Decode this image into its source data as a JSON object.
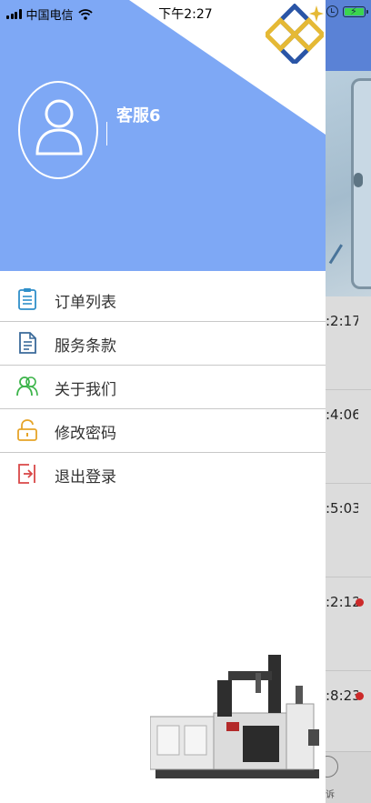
{
  "status_bar": {
    "carrier": "中国电信",
    "time": "下午2:27"
  },
  "drawer": {
    "username": "客服6",
    "menu": [
      {
        "label": "订单列表",
        "icon": "clipboard-icon",
        "color": "#2f8fc9"
      },
      {
        "label": "服务条款",
        "icon": "document-icon",
        "color": "#3a6a9a"
      },
      {
        "label": "关于我们",
        "icon": "people-icon",
        "color": "#3cb44a"
      },
      {
        "label": "修改密码",
        "icon": "lock-icon",
        "color": "#e6a428"
      },
      {
        "label": "退出登录",
        "icon": "exit-icon",
        "color": "#d94848"
      }
    ]
  },
  "background_page": {
    "times": [
      ":2:17",
      ":4:06",
      ":5:03",
      ":2:12",
      ":8:23"
    ],
    "tab_label": "诉"
  },
  "colors": {
    "header_blue": "#7ea8f5",
    "header_dark_blue": "#5a82d6",
    "unread_dot": "#cc2a2a"
  }
}
